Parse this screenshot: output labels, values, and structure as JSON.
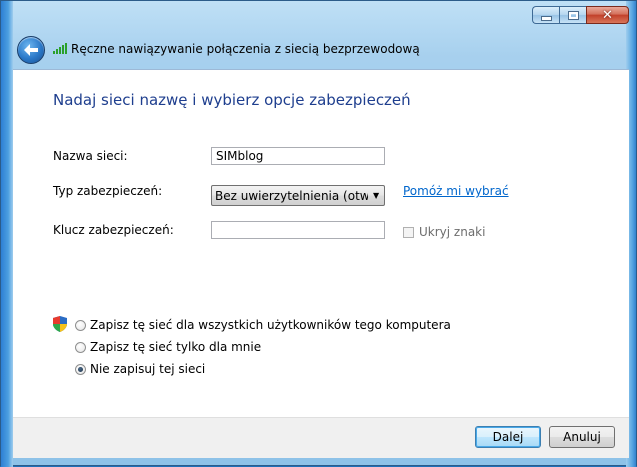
{
  "window": {
    "caption_buttons": {
      "minimize": "minimize-icon",
      "maximize": "maximize-icon",
      "close": "close-icon"
    }
  },
  "nav": {
    "title": "Ręczne nawiązywanie połączenia z siecią bezprzewodową",
    "back_icon": "back-arrow-icon",
    "network_icon": "wireless-signal-icon"
  },
  "main": {
    "heading": "Nadaj sieci nazwę i wybierz opcje zabezpieczeń",
    "network_name": {
      "label": "Nazwa sieci:",
      "value": "SIMblog"
    },
    "security_type": {
      "label": "Typ zabezpieczeń:",
      "value": "Bez uwierzytelnienia (otwarte"
    },
    "help_link": "Pomóż mi wybrać",
    "security_key": {
      "label": "Klucz zabezpieczeń:",
      "value": ""
    },
    "hide_chars": {
      "label": "Ukryj znaki",
      "checked": false,
      "enabled": false
    },
    "save_options": [
      {
        "label": "Zapisz tę sieć dla wszystkich użytkowników tego komputera",
        "checked": false,
        "icon": "uac-shield-icon"
      },
      {
        "label": "Zapisz tę sieć tylko dla mnie",
        "checked": false
      },
      {
        "label": "Nie zapisuj tej sieci",
        "checked": true
      }
    ]
  },
  "footer": {
    "next_label": "Dalej",
    "cancel_label": "Anuluj"
  },
  "colors": {
    "heading": "#1e3e8e",
    "link": "#0066cc",
    "frame": "#8ec2e8"
  }
}
